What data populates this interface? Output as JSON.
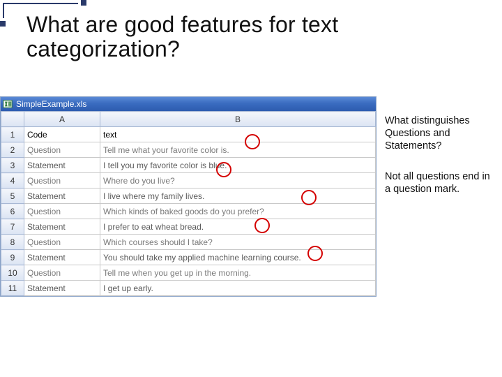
{
  "title_line1": "What are good features for text",
  "title_line2": "categorization?",
  "window_title": "SimpleExample.xls",
  "columns": {
    "rowcorner": "",
    "A": "A",
    "B": "B"
  },
  "header_row": {
    "num": "1",
    "a": "Code",
    "b": "text"
  },
  "rows": [
    {
      "num": "2",
      "a": "Question",
      "b": "Tell me what your favorite color is."
    },
    {
      "num": "3",
      "a": "Statement",
      "b": "I tell you my favorite color is blue."
    },
    {
      "num": "4",
      "a": "Question",
      "b": "Where do you live?"
    },
    {
      "num": "5",
      "a": "Statement",
      "b": "I live where my family lives."
    },
    {
      "num": "6",
      "a": "Question",
      "b": "Which kinds of baked goods do you prefer?"
    },
    {
      "num": "7",
      "a": "Statement",
      "b": "I prefer to eat wheat bread."
    },
    {
      "num": "8",
      "a": "Question",
      "b": "Which courses should I take?"
    },
    {
      "num": "9",
      "a": "Statement",
      "b": "You should take my applied machine learning course."
    },
    {
      "num": "10",
      "a": "Question",
      "b": "Tell me when you get up in the morning."
    },
    {
      "num": "11",
      "a": "Statement",
      "b": "I get up early."
    }
  ],
  "note1": "What distinguishes Questions and Statements?",
  "note2": "Not all questions end in a question mark."
}
